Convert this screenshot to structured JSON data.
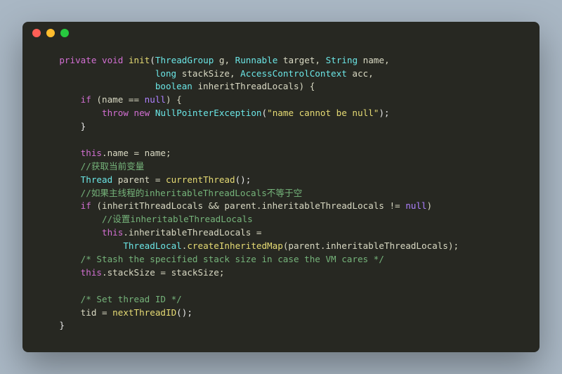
{
  "titlebar": {
    "dots": [
      "red",
      "yellow",
      "green"
    ]
  },
  "code": {
    "l1": {
      "kw1": "private",
      "kw2": "void",
      "fn": "init",
      "p": "(",
      "t1": "ThreadGroup",
      "a1": " g, ",
      "t2": "Runnable",
      "a2": " target, ",
      "t3": "String",
      "a3": " name,"
    },
    "l2": {
      "t1": "long",
      "a1": " stackSize, ",
      "t2": "AccessControlContext",
      "a2": " acc,"
    },
    "l3": {
      "t1": "boolean",
      "a1": " inheritThreadLocals) {"
    },
    "l4": {
      "kw": "if",
      "rest": " (name == ",
      "nul": "null",
      "rest2": ") {"
    },
    "l5": {
      "kw1": "throw",
      "kw2": "new",
      "t": "NullPointerException",
      "p": "(",
      "s": "\"name cannot be null\"",
      "p2": ");"
    },
    "l6": {
      "txt": "}"
    },
    "l8": {
      "this": "this",
      "rest": ".name = name;"
    },
    "l9": {
      "cmt": "//获取当前变量"
    },
    "l10": {
      "t": "Thread",
      "rest": " parent = ",
      "fn": "currentThread",
      "p": "();"
    },
    "l11": {
      "cmt": "//如果主线程的inheritableThreadLocals不等于空"
    },
    "l12": {
      "kw": "if",
      "rest": " (inheritThreadLocals && parent.inheritableThreadLocals != ",
      "nul": "null",
      "rest2": ")"
    },
    "l13": {
      "cmt": "//设置inheritableThreadLocals"
    },
    "l14": {
      "this": "this",
      "rest": ".inheritableThreadLocals ="
    },
    "l15": {
      "t": "ThreadLocal",
      "rest": ".",
      "fn": "createInheritedMap",
      "rest2": "(parent.inheritableThreadLocals);"
    },
    "l16": {
      "cmt": "/* Stash the specified stack size in case the VM cares */"
    },
    "l17": {
      "this": "this",
      "rest": ".stackSize = stackSize;"
    },
    "l19": {
      "cmt": "/* Set thread ID */"
    },
    "l20": {
      "rest": "tid = ",
      "fn": "nextThreadID",
      "p": "();"
    },
    "l21": {
      "txt": "}"
    }
  }
}
